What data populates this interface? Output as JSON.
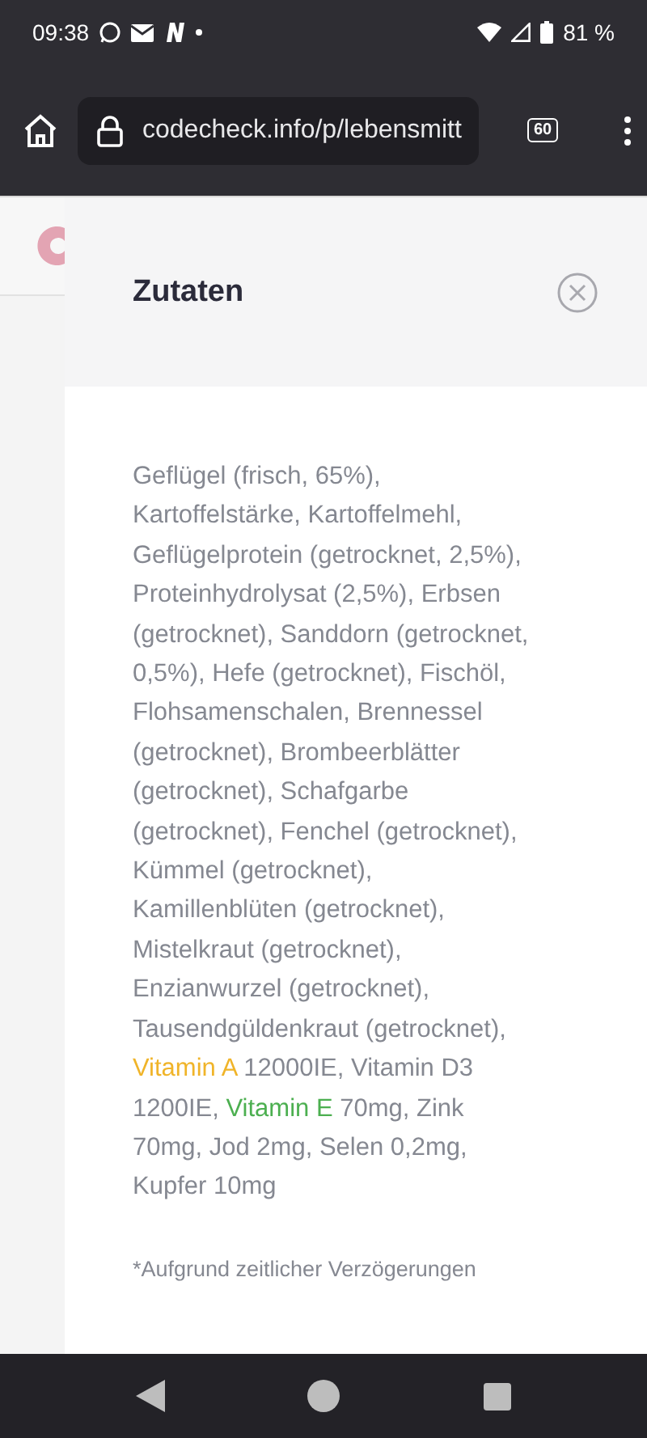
{
  "status_bar": {
    "time": "09:38",
    "battery": "81 %"
  },
  "browser": {
    "url": "codecheck.info/p/lebensmitt",
    "tab_count": "60"
  },
  "modal": {
    "title": "Zutaten",
    "ingredients": [
      {
        "text": "Geflügel (frisch, 65%), Kartoffelstärke, Kartoffelmehl, Geflügelprotein (getrocknet, 2,5%), Proteinhydrolysat (2,5%), Erbsen (getrocknet), Sanddorn (getrocknet, 0,5%), Hefe (getrocknet), Fischöl, Flohsamenschalen, Brennessel (getrocknet), Brombeerblätter (getrocknet), Schafgarbe (getrocknet), Fenchel (getrocknet), Kümmel (getrocknet), Kamillenblüten (getrocknet), Mistelkraut (getrocknet), Enzianwurzel (getrocknet), Tausendgüldenkraut (getrocknet), "
      },
      {
        "text": "Vitamin A",
        "color": "#f0b429"
      },
      {
        "text": " 12000IE, Vitamin D3 1200IE, "
      },
      {
        "text": "Vitamin E",
        "color": "#4caf50"
      },
      {
        "text": " 70mg, Zink 70mg, Jod 2mg, Selen 0,2mg, Kupfer 10mg"
      }
    ],
    "footnote": "*Aufgrund zeitlicher Verzögerungen"
  }
}
